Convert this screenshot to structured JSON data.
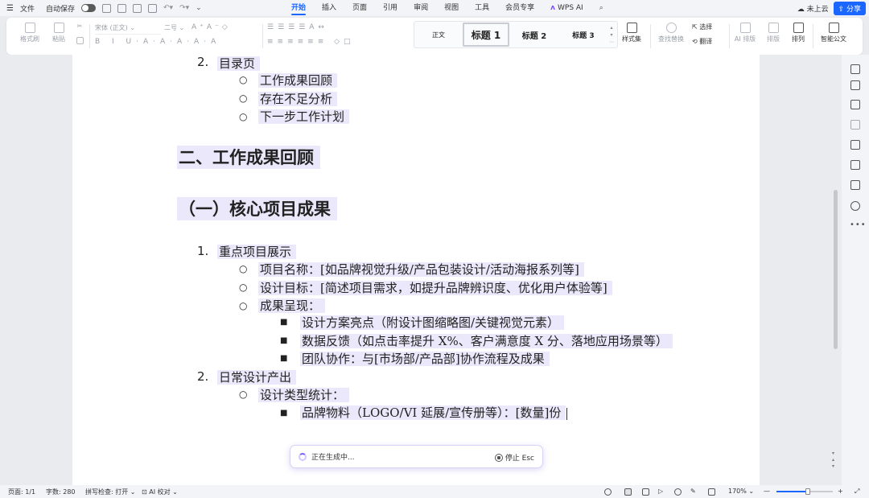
{
  "menubar": {
    "menu_icon": "hamburger-icon",
    "file_label": "文件",
    "autosave_label": "自动保存",
    "tabs": [
      "开始",
      "插入",
      "页面",
      "引用",
      "审阅",
      "视图",
      "工具",
      "会员专享"
    ],
    "active_tab": "开始",
    "wps_ai_label": "WPS AI",
    "cloud_label": "未上云",
    "share_label": "分享"
  },
  "ribbon": {
    "format_painter": "格式刷",
    "paste": "粘贴",
    "font_name": "宋体 (正文)",
    "font_size": "二号",
    "styles": {
      "body": "正文",
      "h1": "标题 1",
      "h2": "标题 2",
      "h3": "标题 3"
    },
    "style_set": "样式集",
    "find_replace": "查找替换",
    "select": "选择",
    "translate": "翻译",
    "ai_layout": "AI 排版",
    "layout": "排版",
    "arrange": "排列",
    "smart_doc": "智能公文"
  },
  "document": {
    "toc_num": "2.",
    "toc_title": "目录页",
    "toc_items": [
      "工作成果回顾",
      "存在不足分析",
      "下一步工作计划"
    ],
    "section2": "二、工作成果回顾",
    "subsection1": "（一）核心项目成果",
    "item1_num": "1.",
    "item1_title": "重点项目展示",
    "item1_bullets": [
      "项目名称：[如品牌视觉升级/产品包装设计/活动海报系列等]",
      "设计目标：[简述项目需求，如提升品牌辨识度、优化用户体验等]",
      "成果呈现："
    ],
    "item1_sub": [
      "设计方案亮点（附设计图缩略图/关键视觉元素）",
      "数据反馈（如点击率提升 X%、客户满意度 X 分、落地应用场景等）",
      "团队协作：与[市场部/产品部]协作流程及成果"
    ],
    "item2_num": "2.",
    "item2_title": "日常设计产出",
    "item2_bullets": [
      "设计类型统计："
    ],
    "item2_sub": [
      "品牌物料（LOGO/VI 延展/宣传册等）：[数量]份"
    ],
    "bullet_circle": "○",
    "bullet_square": "■"
  },
  "ai_status": {
    "generating": "正在生成中...",
    "stop": "停止 Esc"
  },
  "statusbar": {
    "page": "页面: 1/1",
    "words": "字数: 280",
    "spellcheck": "拼写检查: 打开",
    "ai_proof": "AI 校对",
    "zoom": "170%"
  }
}
